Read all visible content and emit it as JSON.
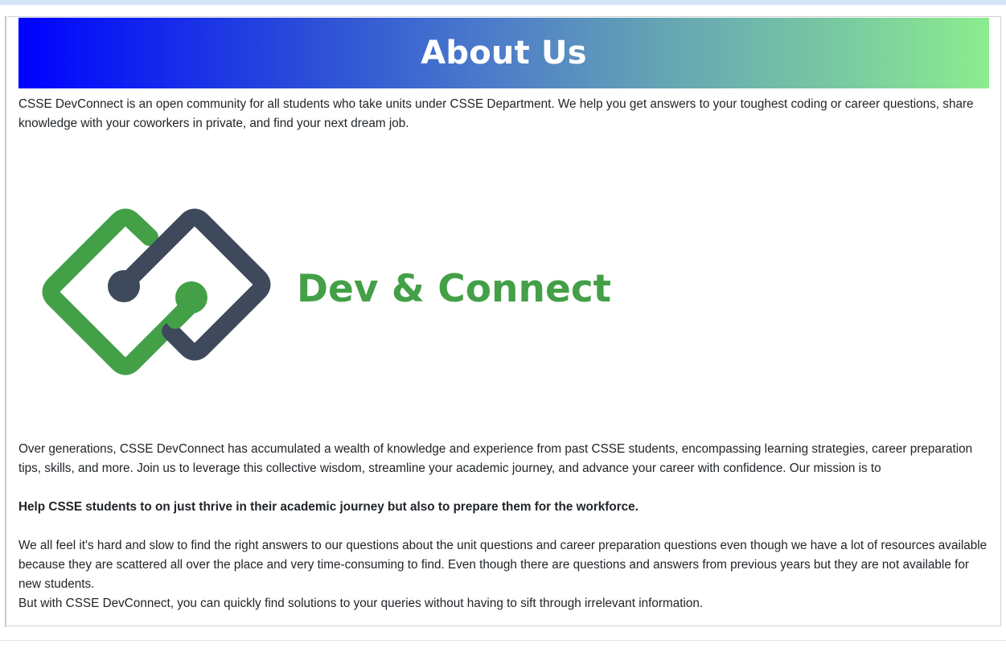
{
  "header": {
    "title": "About Us"
  },
  "intro": {
    "text": "CSSE DevConnect is an open community for all students who take units under CSSE Department. We help you get answers to your toughest coding or career questions, share knowledge with your coworkers in private, and find your next dream job."
  },
  "logo": {
    "text": "Dev & Connect",
    "colors": {
      "green": "#43a047",
      "slate": "#3e4a5b"
    }
  },
  "body": {
    "history": "Over generations, CSSE DevConnect has accumulated a wealth of knowledge and experience from past CSSE students, encompassing learning strategies, career preparation tips, skills, and more. Join us to leverage this collective wisdom, streamline your academic journey, and advance your career with confidence. Our mission is to",
    "mission": "Help CSSE students to on just thrive in their academic journey but also to prepare them for the workforce.",
    "problem": "We all feel it's hard and slow to find the right answers to our questions about the unit questions and career preparation questions even though we have a lot of resources available because they are scattered all over the place and very time-consuming to find. Even though there are questions and answers from previous years but they are not available for new students.",
    "solution": "But with CSSE DevConnect, you can quickly find solutions to your queries without having to sift through irrelevant information."
  },
  "colors": {
    "banner_start": "#0000ff",
    "banner_end": "#8cec8e",
    "text": "#212529"
  }
}
